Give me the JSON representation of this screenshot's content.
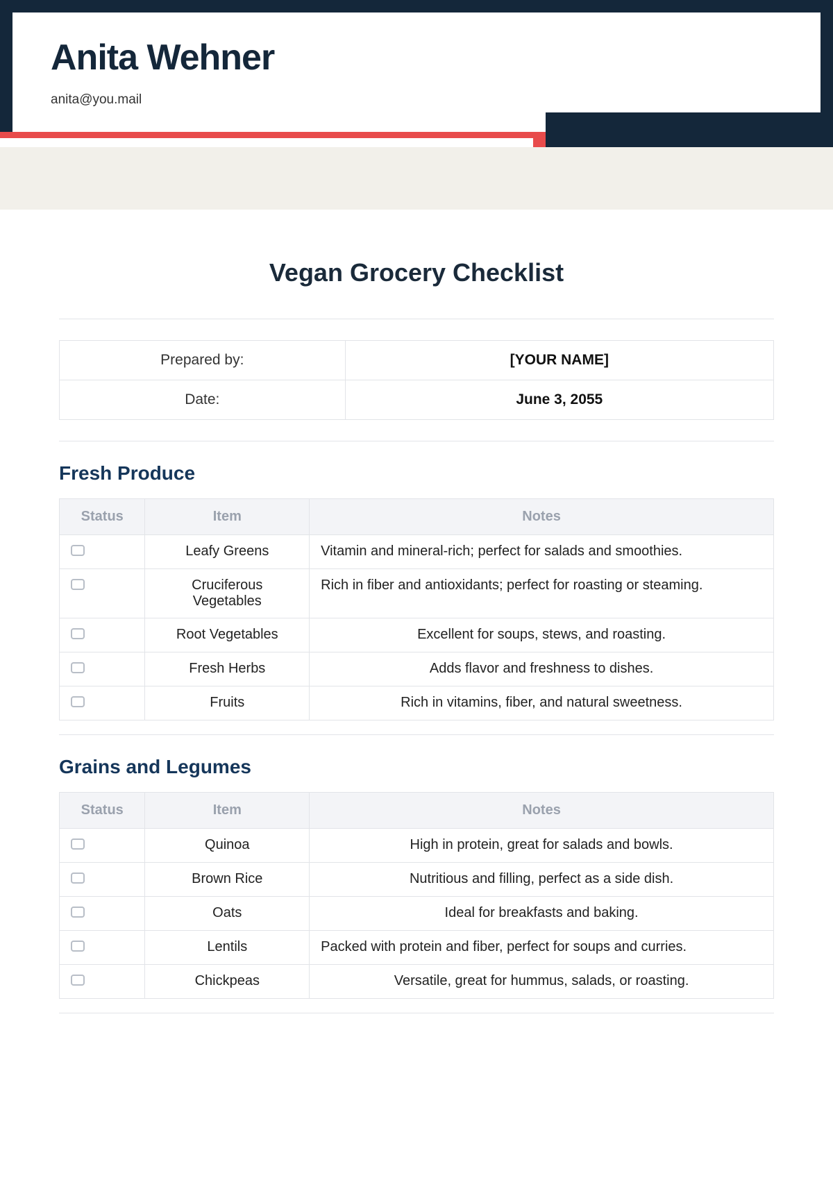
{
  "header": {
    "name": "Anita Wehner",
    "email": "anita@you.mail"
  },
  "document": {
    "title": "Vegan Grocery Checklist"
  },
  "meta": {
    "prepared_by_label": "Prepared by:",
    "prepared_by_value": "[YOUR NAME]",
    "date_label": "Date:",
    "date_value": "June 3, 2055"
  },
  "columns": {
    "status": "Status",
    "item": "Item",
    "notes": "Notes"
  },
  "sections": [
    {
      "title": "Fresh Produce",
      "rows": [
        {
          "item": "Leafy Greens",
          "notes": "Vitamin and mineral-rich; perfect for salads and smoothies.",
          "notes_align": "left"
        },
        {
          "item": "Cruciferous Vegetables",
          "notes": "Rich in fiber and antioxidants; perfect for roasting or steaming.",
          "notes_align": "left"
        },
        {
          "item": "Root Vegetables",
          "notes": "Excellent for soups, stews, and roasting.",
          "notes_align": "center"
        },
        {
          "item": "Fresh Herbs",
          "notes": "Adds flavor and freshness to dishes.",
          "notes_align": "center"
        },
        {
          "item": "Fruits",
          "notes": "Rich in vitamins, fiber, and natural sweetness.",
          "notes_align": "center"
        }
      ]
    },
    {
      "title": "Grains and Legumes",
      "rows": [
        {
          "item": "Quinoa",
          "notes": "High in protein, great for salads and bowls.",
          "notes_align": "center"
        },
        {
          "item": "Brown Rice",
          "notes": "Nutritious and filling, perfect as a side dish.",
          "notes_align": "center"
        },
        {
          "item": "Oats",
          "notes": "Ideal for breakfasts and baking.",
          "notes_align": "center"
        },
        {
          "item": "Lentils",
          "notes": "Packed with protein and fiber, perfect for soups and curries.",
          "notes_align": "left"
        },
        {
          "item": "Chickpeas",
          "notes": "Versatile, great for hummus, salads, or roasting.",
          "notes_align": "center"
        }
      ]
    }
  ]
}
